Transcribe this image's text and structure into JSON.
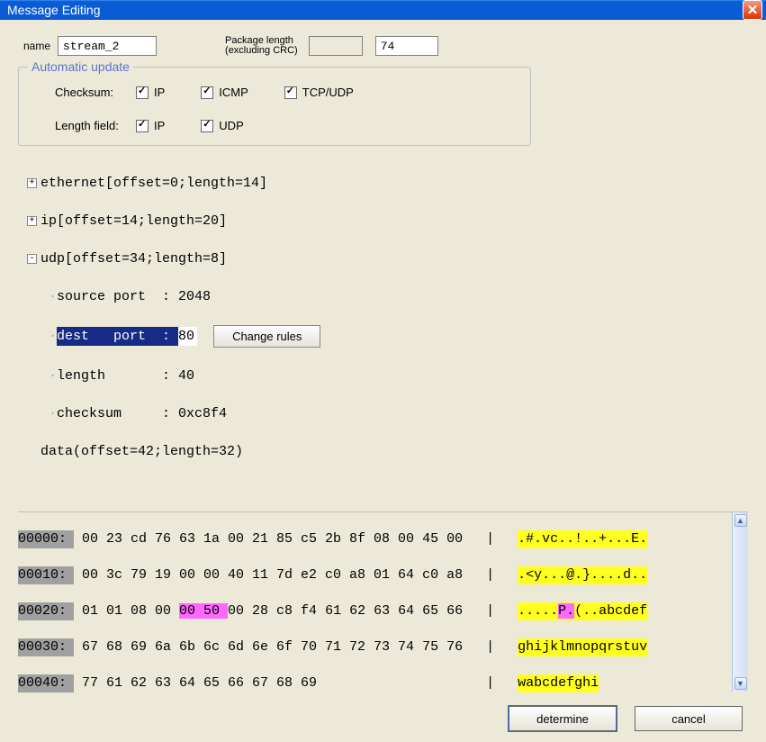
{
  "title": "Message Editing",
  "name_label": "name",
  "name_value": "stream_2",
  "pkg_label1": "Package length",
  "pkg_label2": "(excluding CRC)",
  "pkg_value": "74",
  "fieldset_title": "Automatic update",
  "checksum_label": "Checksum:",
  "lengthfield_label": "Length field:",
  "ck_ip1": "IP",
  "ck_icmp": "ICMP",
  "ck_tcpudp": "TCP/UDP",
  "ck_ip2": "IP",
  "ck_udp": "UDP",
  "tree": {
    "ethernet": {
      "name": "ethernet",
      "info": "[offset=0;length=14]"
    },
    "ip": {
      "name": "ip",
      "info": "[offset=14;length=20]"
    },
    "udp": {
      "name": "udp",
      "info": "[offset=34;length=8]"
    },
    "udp_sourceport": {
      "label": "source port  : ",
      "value": "2048"
    },
    "udp_destport_label": "dest   port  : ",
    "udp_destport_value": "80",
    "udp_length": {
      "label": "length       : ",
      "value": "40"
    },
    "udp_checksum": {
      "label": "checksum     : ",
      "value": "0xc8f4"
    },
    "data": {
      "name": "data",
      "info": "(offset=42;length=32)"
    }
  },
  "change_rules_btn": "Change rules",
  "hex": {
    "row0": {
      "off": "00000:",
      "b": " 00 23 cd 76 63 1a 00 21 85 c5 2b 8f 08 00 45 00",
      "a": ".#.vc..!..+...E."
    },
    "row1": {
      "off": "00010:",
      "b": " 00 3c 79 19 00 00 40 11 7d e2 c0 a8 01 64 c0 a8",
      "a": ".<y...@.}....d.."
    },
    "row2_off": "00020:",
    "row2_b_pre": " 01 01 08 00 ",
    "row2_b_hl": "00 50 ",
    "row2_b_post": "00 28 c8 f4 61 62 63 64 65 66",
    "row2_a_pre": ".....",
    "row2_a_hl": "P.",
    "row2_a_post": "(..abcdef",
    "row3": {
      "off": "00030:",
      "b": " 67 68 69 6a 6b 6c 6d 6e 6f 70 71 72 73 74 75 76",
      "a": "ghijklmnopqrstuv"
    },
    "row4": {
      "off": "00040:",
      "b": " 77 61 62 63 64 65 66 67 68 69",
      "a": "wabcdefghi"
    }
  },
  "determine_btn": "determine",
  "cancel_btn": "cancel"
}
